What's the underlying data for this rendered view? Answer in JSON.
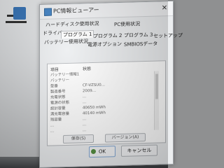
{
  "window": {
    "title": "PC情報ビューアー",
    "close_glyph": "✕"
  },
  "tabs": {
    "row1": [
      "ハードディスク使用状況",
      "PC使用状況"
    ],
    "row2": [
      "ドライバー",
      "プログラム 1",
      "プログラム 2",
      "プログラム 3",
      "セットアップ"
    ],
    "row3": [
      "バッテリー使用状況",
      "電源オプション",
      "SMBIOSデータ"
    ],
    "active": "プログラム 1"
  },
  "panel": {
    "columns": [
      "項目",
      "状態"
    ],
    "rows": [
      {
        "k": "バッテリー情報1",
        "v": ""
      },
      {
        "k": "バッテリー",
        "v": ""
      },
      {
        "k": "型番",
        "v": "CF-VZSU0…"
      },
      {
        "k": "製造番号",
        "v": "2009…"
      },
      {
        "k": "充電状態",
        "v": "…"
      },
      {
        "k": "電源の状態",
        "v": "…"
      },
      {
        "k": "設計容量",
        "v": "40650 mWh"
      },
      {
        "k": "満充電容量",
        "v": "40140 mWh"
      },
      {
        "k": "残容量",
        "v": "…"
      },
      {
        "k": "…",
        "v": "…"
      },
      {
        "k": "…",
        "v": "…"
      }
    ],
    "buttons": [
      "保存(S)",
      "バージョン(A)"
    ]
  },
  "footer": {
    "ok_label": "OK",
    "cancel_label": "キャンセル"
  },
  "desktop": {
    "icon_label": ""
  }
}
